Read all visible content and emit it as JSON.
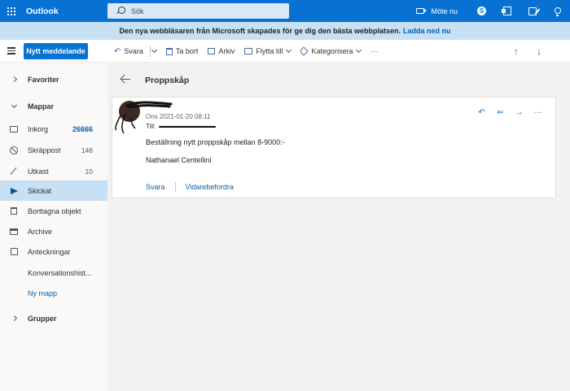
{
  "app": {
    "name": "Outlook"
  },
  "search": {
    "placeholder": "Sök"
  },
  "topbar": {
    "meet_now": "Möte nu",
    "skype": "S"
  },
  "banner": {
    "text": "Den nya webbläsaren från Microsoft skapades för ge dig den bästa webbplatsen.",
    "link": "Ladda ned nu"
  },
  "toolbar": {
    "new_message": "Nytt meddelande",
    "reply": "Svara",
    "delete": "Ta bort",
    "archive": "Arkiv",
    "move": "Flytta till",
    "categorize": "Kategorisera",
    "more": "···"
  },
  "sidebar": {
    "favorites": "Favoriter",
    "folders": "Mappar",
    "items": [
      {
        "label": "Inkorg",
        "count": "26666"
      },
      {
        "label": "Skräppost",
        "count": "146"
      },
      {
        "label": "Utkast",
        "count": "10"
      },
      {
        "label": "Skickat",
        "count": ""
      },
      {
        "label": "Borttagna objekt",
        "count": ""
      },
      {
        "label": "Archive",
        "count": ""
      },
      {
        "label": "Anteckningar",
        "count": ""
      },
      {
        "label": "Konversationshist...",
        "count": ""
      }
    ],
    "new_folder": "Ny mapp",
    "groups": "Grupper"
  },
  "message": {
    "subject": "Proppskåp",
    "date": "Ons 2021-01-20 08:11",
    "to_label": "Till:",
    "body_line1": "Beställning nytt proppskåp mellan 8-9000:-",
    "body_line2": "Nathanael Centellini",
    "reply": "Svara",
    "forward": "Vidarebefordra",
    "more": "···"
  },
  "colors": {
    "accent": "#0872d2",
    "banner": "#c7e0f4",
    "selected": "#c7e0f4"
  }
}
